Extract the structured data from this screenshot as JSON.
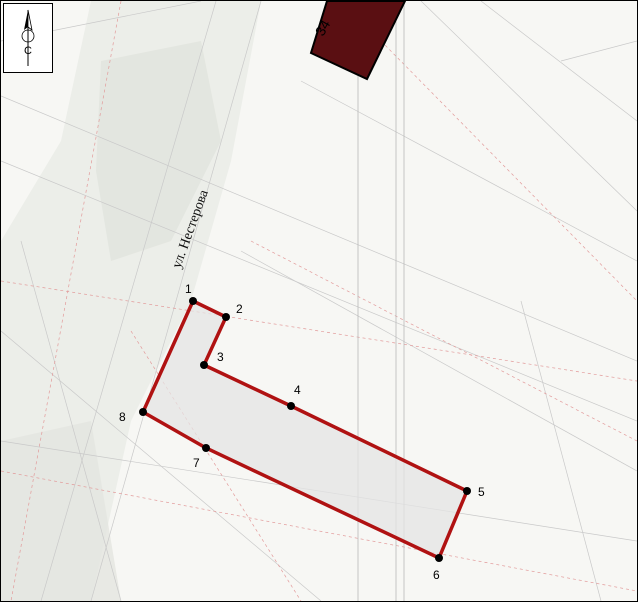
{
  "north_arrow": {
    "label": "С",
    "icon": "north-arrow-icon"
  },
  "street": {
    "name": "ул. Нестерова"
  },
  "building": {
    "number": "34",
    "color": "#5a0f12"
  },
  "plot": {
    "outline_color": "#b01212",
    "fill_color": "#e4e4e4",
    "points": [
      {
        "label": "1"
      },
      {
        "label": "2"
      },
      {
        "label": "3"
      },
      {
        "label": "4"
      },
      {
        "label": "5"
      },
      {
        "label": "6"
      },
      {
        "label": "7"
      },
      {
        "label": "8"
      }
    ]
  }
}
